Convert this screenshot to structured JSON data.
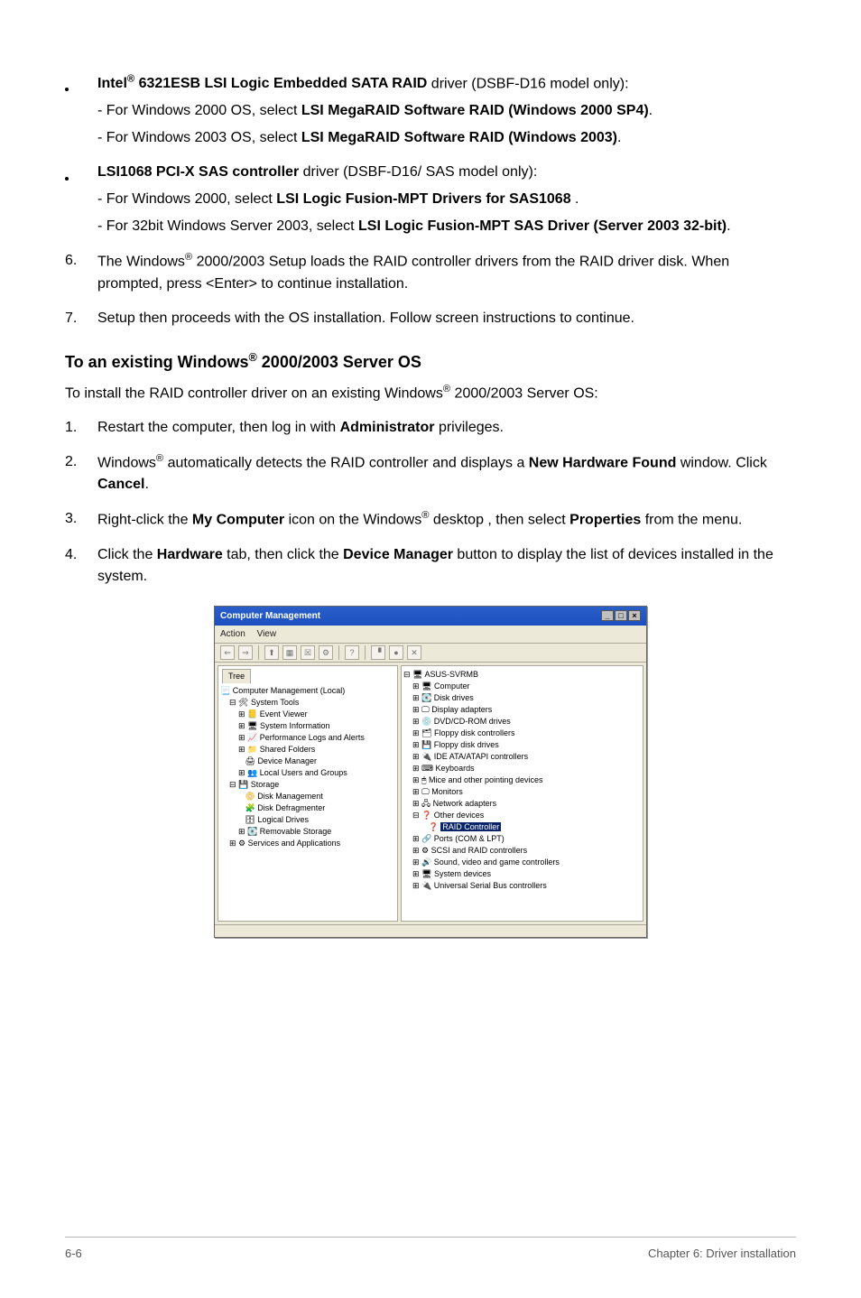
{
  "bullets": [
    {
      "lead_pre": "Intel",
      "lead_sup": "®",
      "lead_post": " 6321ESB LSI Logic Embedded SATA RAID",
      "trail": " driver (DSBF-D16 model only):",
      "subs": [
        {
          "pre": "- For Windows 2000 OS, select ",
          "bold": "LSI MegaRAID Software RAID (Windows 2000 SP4)",
          "post": "."
        },
        {
          "pre": "- For Windows 2003 OS, select ",
          "bold": "LSI MegaRAID Software RAID (Windows 2003)",
          "post": "."
        }
      ]
    },
    {
      "lead_pre": "",
      "lead_sup": "",
      "lead_post": "LSI1068 PCI-X SAS controller",
      "trail": " driver (DSBF-D16/ SAS model only):",
      "subs": [
        {
          "pre": "- For Windows 2000, select ",
          "bold": "LSI Logic Fusion-MPT Drivers for SAS1068 ",
          "post": "."
        },
        {
          "pre": "- For 32bit Windows Server 2003, select ",
          "bold": "LSI Logic Fusion-MPT SAS Driver (Server 2003 32-bit)",
          "post": "."
        }
      ]
    }
  ],
  "step6": {
    "num": "6.",
    "t1": "The Windows",
    "sup": "®",
    "t2": " 2000/2003 Setup loads the RAID controller drivers from the RAID driver disk. When prompted, press <Enter> to continue installation."
  },
  "step7": {
    "num": "7.",
    "text": "Setup then proceeds with the OS installation. Follow screen instructions to continue."
  },
  "heading": {
    "t1": "To an existing Windows",
    "sup": "®",
    "t2": " 2000/2003 Server OS"
  },
  "intro": {
    "t1": "To install the RAID controller driver on an existing Windows",
    "sup": "®",
    "t2": " 2000/2003 Server OS:"
  },
  "sstep1": {
    "num": "1.",
    "t1": "Restart the computer, then log in with ",
    "b1": "Administrator",
    "t2": " privileges."
  },
  "sstep2": {
    "num": "2.",
    "t1": "Windows",
    "sup": "®",
    "t2": " automatically detects the RAID controller and displays a ",
    "b1": "New Hardware Found",
    "t3": " window. Click ",
    "b2": "Cancel",
    "t4": "."
  },
  "sstep3": {
    "num": "3.",
    "t1": "Right-click the ",
    "b1": "My Computer",
    "t2": " icon on the Windows",
    "sup": "®",
    "t3": " desktop , then select ",
    "b2": "Properties",
    "t4": " from the menu."
  },
  "sstep4": {
    "num": "4.",
    "t1": "Click the ",
    "b1": "Hardware",
    "t2": " tab, then click the ",
    "b2": "Device Manager",
    "t3": " button to display the list of devices installed in the system."
  },
  "dlg": {
    "title": "Computer Management",
    "menu": {
      "action": "Action",
      "view": "View"
    },
    "toolbar_icons": [
      "⇐",
      "⇒",
      "⬆",
      "▦",
      "☒",
      "⚙",
      "?",
      "▝",
      "●",
      "✕"
    ],
    "left": {
      "tab": "Tree",
      "root": "Computer Management (Local)",
      "sys_tools": "System Tools",
      "event_viewer": "Event Viewer",
      "sys_info": "System Information",
      "perf_logs": "Performance Logs and Alerts",
      "shared": "Shared Folders",
      "dev_mgr": "Device Manager",
      "local_users": "Local Users and Groups",
      "storage": "Storage",
      "disk_mgmt": "Disk Management",
      "disk_defrag": "Disk Defragmenter",
      "logical": "Logical Drives",
      "removable": "Removable Storage",
      "services": "Services and Applications"
    },
    "right": {
      "root": "ASUS-SVRMB",
      "computer": "Computer",
      "disk_drives": "Disk drives",
      "display": "Display adapters",
      "dvd": "DVD/CD-ROM drives",
      "floppy_ctrl": "Floppy disk controllers",
      "floppy_drv": "Floppy disk drives",
      "ide": "IDE ATA/ATAPI controllers",
      "keyboards": "Keyboards",
      "mice": "Mice and other pointing devices",
      "monitors": "Monitors",
      "network": "Network adapters",
      "other": "Other devices",
      "raid": "RAID Controller",
      "ports": "Ports (COM & LPT)",
      "scsi": "SCSI and RAID controllers",
      "sound": "Sound, video and game controllers",
      "system_dev": "System devices",
      "usb": "Universal Serial Bus controllers"
    }
  },
  "footer": {
    "left": "6-6",
    "right": "Chapter 6: Driver installation"
  }
}
